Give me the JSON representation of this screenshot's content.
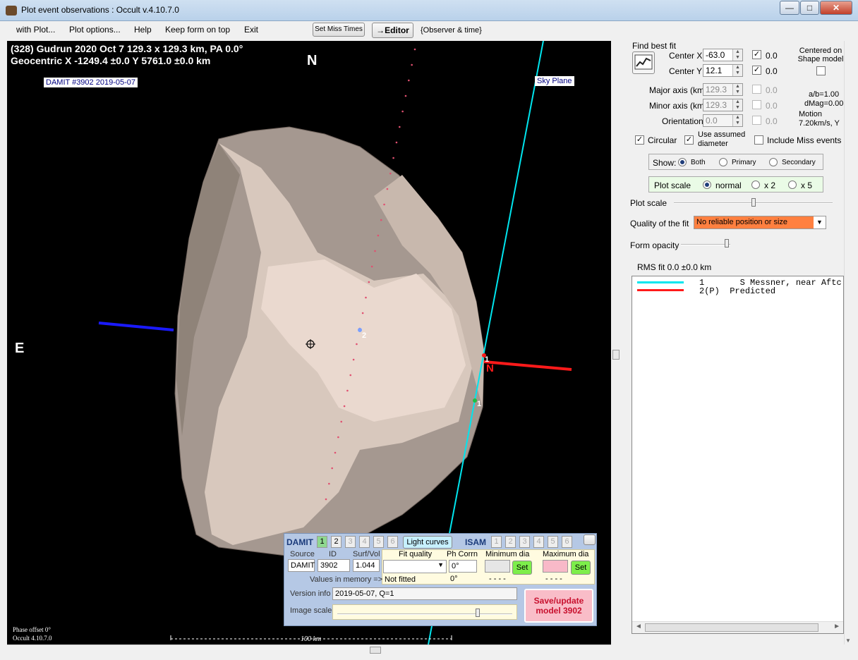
{
  "window": {
    "title": "Plot event observations : Occult v.4.10.7.0",
    "min": "—",
    "max": "□",
    "close": "✕"
  },
  "menu": {
    "with_plot": "with Plot...",
    "plot_options": "Plot options...",
    "help": "Help",
    "keep_on_top": "Keep form on top",
    "exit": "Exit",
    "set_miss_times": "Set Miss Times",
    "editor": "→Editor",
    "observer_time": "{Observer & time}"
  },
  "plot": {
    "header1": "(328) Gudrun  2020 Oct 7   129.3 x 129.3 km,  PA 0.0°",
    "header2": "Geocentric  X  -1249.4 ±0.0   Y 5761.0 ±0.0 km",
    "north": "N",
    "east": "E",
    "damit_tag": "DAMIT #3902 2019-05-07",
    "sky_plane": "Sky Plane",
    "phase_offset": "Phase offset 0°",
    "version": "Occult 4.10.7.0",
    "scale_label": "100 km",
    "n_red": "N",
    "chord_label_1a": "1",
    "chord_label_1b": "1",
    "chord_label_2": "2"
  },
  "damit": {
    "title": "DAMIT",
    "isam": "ISAM",
    "nums": [
      "1",
      "2",
      "3",
      "4",
      "5",
      "6"
    ],
    "light_curves": "Light curves",
    "source_h": "Source",
    "id_h": "ID",
    "surfvol_h": "Surf/Vol",
    "source": "DAMIT",
    "id": "3902",
    "surfvol": "1.044",
    "fit_quality_h": "Fit quality",
    "ph_corr_h": "Ph Corrn",
    "min_dia_h": "Minimum dia",
    "max_dia_h": "Maximum dia",
    "ph_corr": "0°",
    "set": "Set",
    "values_in_memory": "Values in memory =>",
    "not_fitted": "Not fitted",
    "ph_corr_mem": "0°",
    "min_dia_mem": "- - - -",
    "max_dia_mem": "- - - -",
    "version_info_lbl": "Version info",
    "version_info": "2019-05-07, Q=1",
    "image_scale_lbl": "Image scale",
    "save_btn": "Save/update model 3902"
  },
  "right": {
    "find_best_fit": "Find best fit",
    "center_x_lbl": "Center X",
    "center_x": "-63.0",
    "center_x_v": "0.0",
    "center_y_lbl": "Center Y",
    "center_y": "12.1",
    "center_y_v": "0.0",
    "centered_on": "Centered on Shape model",
    "major_lbl": "Major axis (km)",
    "major": "129.3",
    "major_v": "0.0",
    "minor_lbl": "Minor axis (km)",
    "minor": "129.3",
    "minor_v": "0.0",
    "orient_lbl": "Orientation",
    "orient": "0.0",
    "orient_v": "0.0",
    "ab": "a/b=1.00",
    "dmag": "dMag=0.00",
    "motion": "Motion",
    "motion_v": "7.20km/s, Y",
    "circular": "Circular",
    "use_assumed": "Use assumed diameter",
    "include_miss": "Include Miss events",
    "show_lbl": "Show:",
    "both": "Both",
    "primary": "Primary",
    "secondary": "Secondary",
    "plot_scale_grp": "Plot scale",
    "normal": "normal",
    "x2": "x 2",
    "x5": "x 5",
    "plot_scale": "Plot scale",
    "quality_lbl": "Quality of the fit",
    "quality": "No reliable position or size",
    "form_opacity": "Form opacity",
    "rms": "RMS fit 0.0 ±0.0 km",
    "legend": [
      {
        "num": "1",
        "text": "S Messner, near Aftc",
        "color": "#00e5ee"
      },
      {
        "num": "2(P)",
        "text": "Predicted",
        "color": "#ff1a1a"
      }
    ]
  }
}
